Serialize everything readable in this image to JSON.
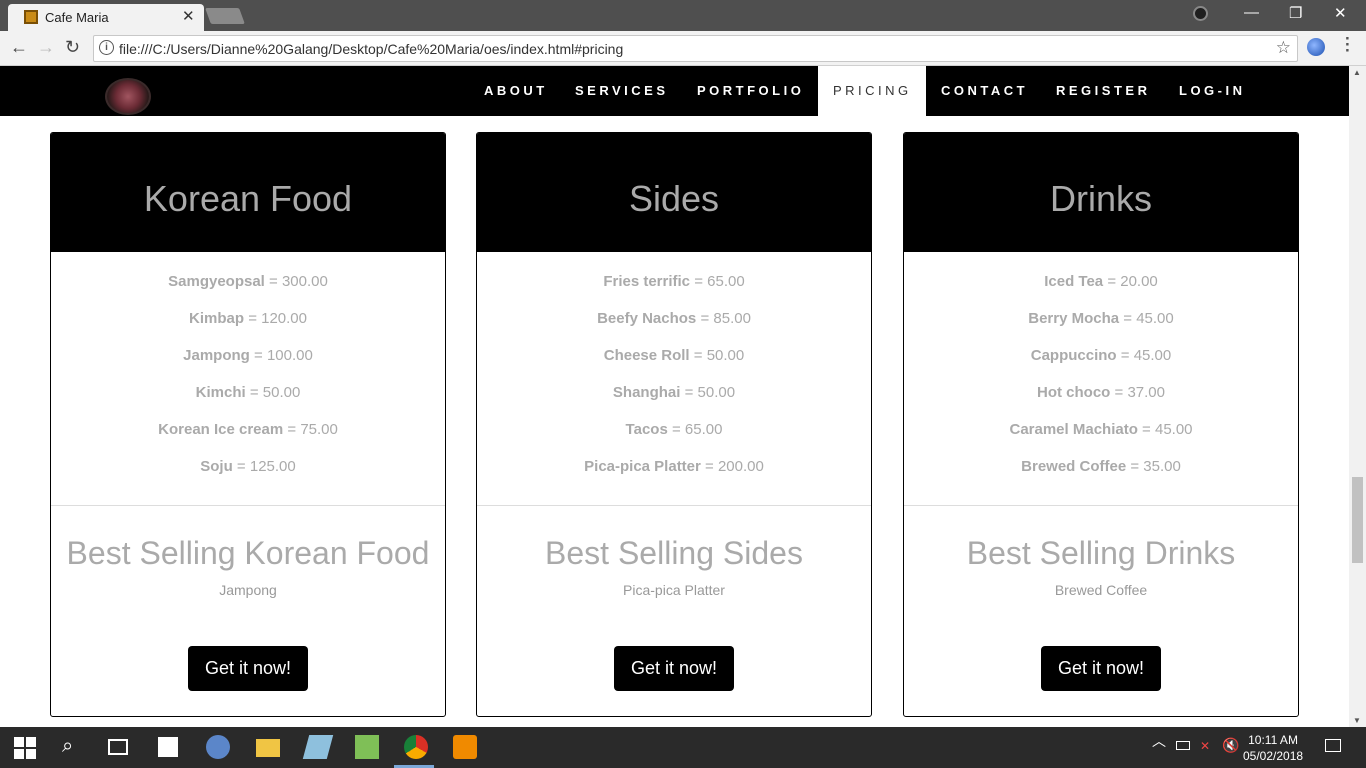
{
  "browser": {
    "tab_title": "Cafe Maria",
    "url": "file:///C:/Users/Dianne%20Galang/Desktop/Cafe%20Maria/oes/index.html#pricing"
  },
  "nav": {
    "items": [
      "ABOUT",
      "SERVICES",
      "PORTFOLIO",
      "PRICING",
      "CONTACT",
      "REGISTER",
      "LOG-IN"
    ],
    "active": "PRICING"
  },
  "cards": [
    {
      "title": "Korean Food",
      "items": [
        {
          "name": "Samgyeopsal",
          "price": "= 300.00"
        },
        {
          "name": "Kimbap",
          "price": "= 120.00"
        },
        {
          "name": "Jampong",
          "price": "= 100.00"
        },
        {
          "name": "Kimchi",
          "price": "= 50.00"
        },
        {
          "name": "Korean Ice cream",
          "price": "= 75.00"
        },
        {
          "name": "Soju",
          "price": "= 125.00"
        }
      ],
      "best_title": "Best Selling Korean Food",
      "best_item": "Jampong",
      "button": "Get it now!"
    },
    {
      "title": "Sides",
      "items": [
        {
          "name": "Fries terrific",
          "price": "= 65.00"
        },
        {
          "name": "Beefy Nachos",
          "price": "= 85.00"
        },
        {
          "name": "Cheese Roll",
          "price": "= 50.00"
        },
        {
          "name": "Shanghai",
          "price": "= 50.00"
        },
        {
          "name": "Tacos",
          "price": "= 65.00"
        },
        {
          "name": "Pica-pica Platter",
          "price": "= 200.00"
        }
      ],
      "best_title": "Best Selling Sides",
      "best_item": "Pica-pica Platter",
      "button": "Get it now!"
    },
    {
      "title": "Drinks",
      "items": [
        {
          "name": "Iced Tea",
          "price": "= 20.00"
        },
        {
          "name": "Berry Mocha",
          "price": "= 45.00"
        },
        {
          "name": "Cappuccino",
          "price": "= 45.00"
        },
        {
          "name": "Hot choco",
          "price": "= 37.00"
        },
        {
          "name": "Caramel Machiato",
          "price": "= 45.00"
        },
        {
          "name": "Brewed Coffee",
          "price": "= 35.00"
        }
      ],
      "best_title": "Best Selling Drinks",
      "best_item": "Brewed Coffee",
      "button": "Get it now!"
    }
  ],
  "taskbar": {
    "time": "10:11 AM",
    "date": "05/02/2018"
  },
  "colors": {
    "navbar_bg": "#000000",
    "card_head_bg": "#000000",
    "muted_text": "#aaaaaa",
    "button_bg": "#000000"
  }
}
